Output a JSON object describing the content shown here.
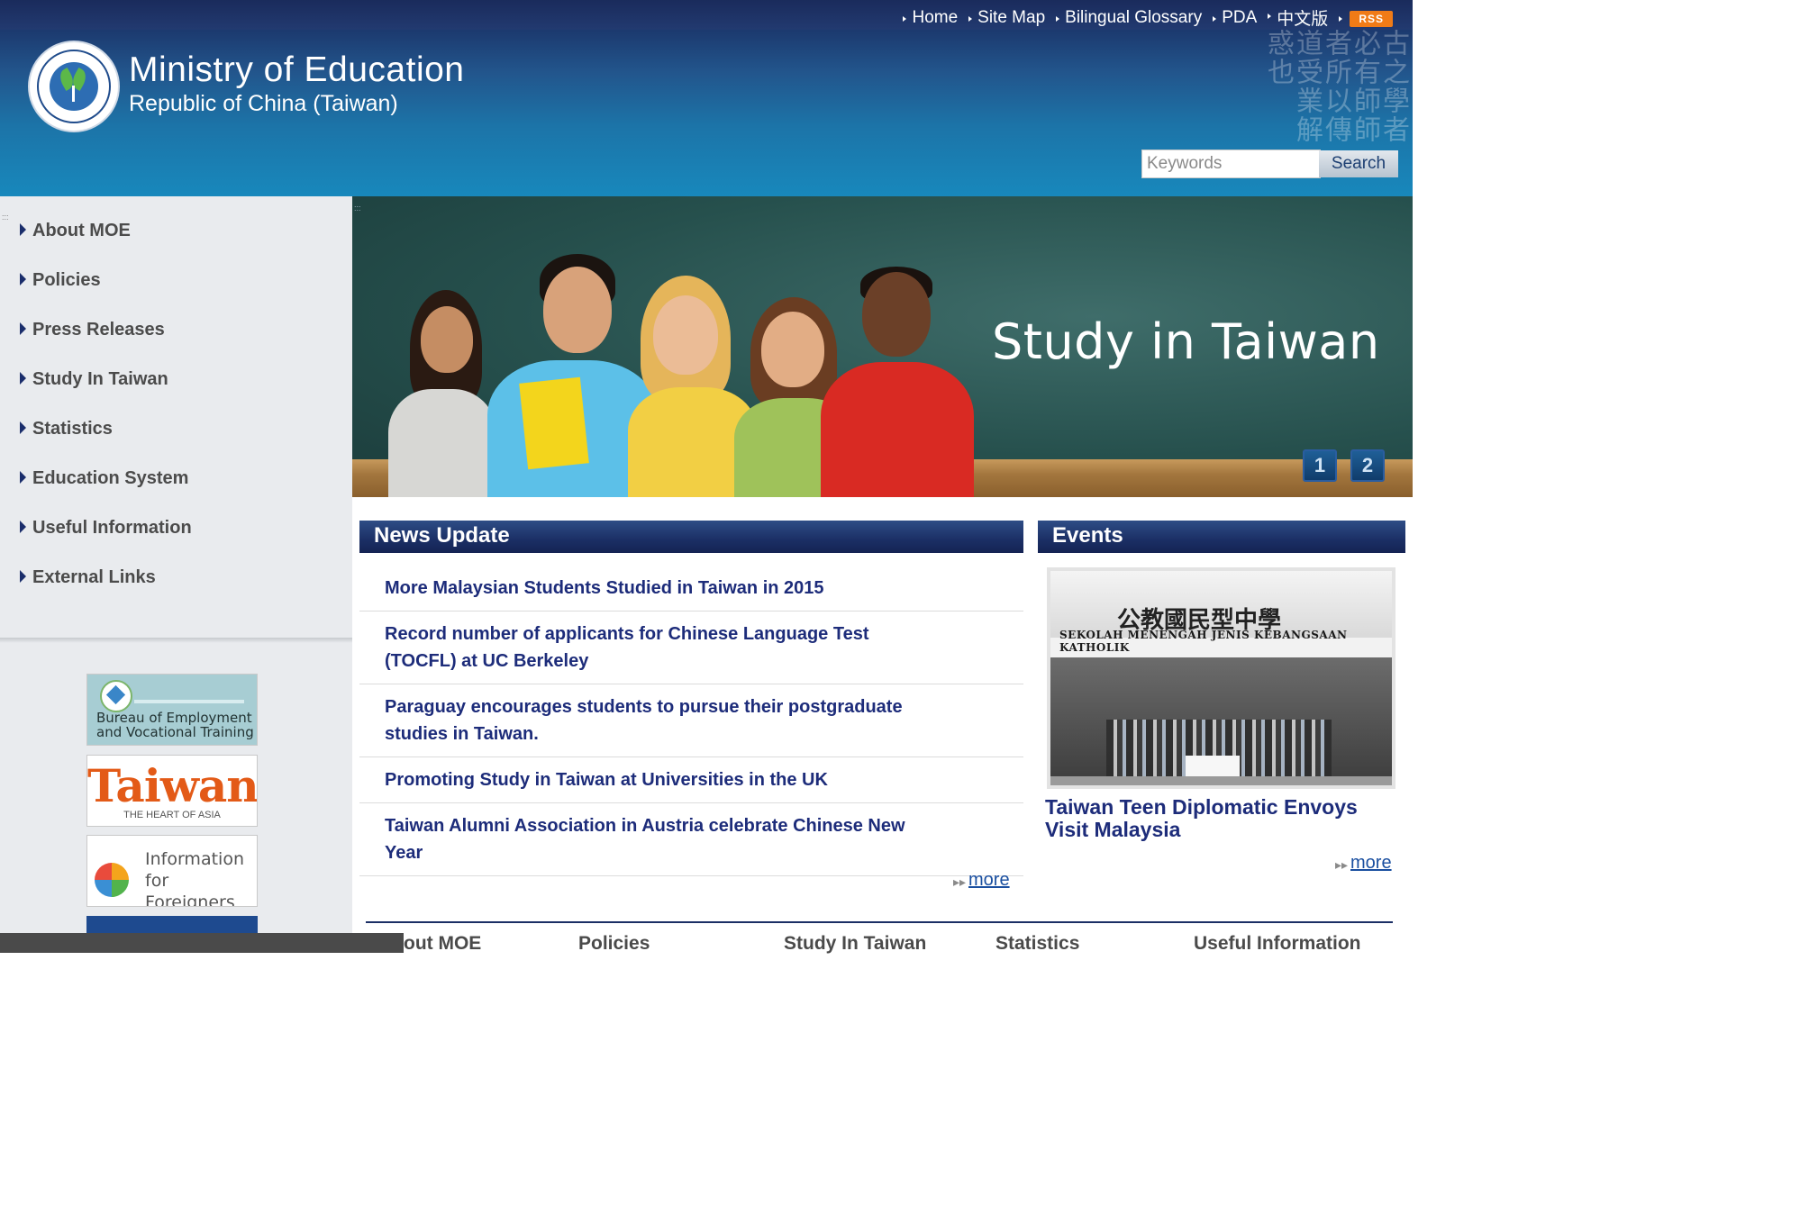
{
  "topnav": {
    "items": [
      {
        "label": "Home"
      },
      {
        "label": "Site Map"
      },
      {
        "label": "Bilingual Glossary"
      },
      {
        "label": "PDA"
      },
      {
        "label": "中文版"
      }
    ],
    "rss_label": "RSS"
  },
  "header": {
    "title": "Ministry of Education",
    "subtitle": "Republic of China (Taiwan)",
    "calligraphy": "古之學者必有師師者所以傳道受業解惑也",
    "search": {
      "placeholder": "Keywords",
      "button_label": "Search"
    }
  },
  "sidebar": {
    "menu": [
      {
        "label": "About MOE"
      },
      {
        "label": "Policies"
      },
      {
        "label": "Press Releases"
      },
      {
        "label": "Study In Taiwan"
      },
      {
        "label": "Statistics"
      },
      {
        "label": "Education System"
      },
      {
        "label": "Useful Information"
      },
      {
        "label": "External Links"
      }
    ],
    "banners": {
      "bevt": "Bureau of Employment and Vocational Training",
      "taiwan_title": "Taiwan",
      "taiwan_tagline": "THE HEART OF ASIA",
      "info": "Information for Foreigners"
    }
  },
  "slideshow": {
    "caption": "Study in Taiwan",
    "pages": [
      "1",
      "2"
    ]
  },
  "news": {
    "heading": "News Update",
    "items": [
      {
        "title": "More Malaysian Students Studied in Taiwan in 2015"
      },
      {
        "title": "Record number of applicants for Chinese Language Test (TOCFL) at UC Berkeley"
      },
      {
        "title": "Paraguay encourages students to pursue their postgraduate studies in Taiwan."
      },
      {
        "title": "Promoting Study in Taiwan at Universities in the UK"
      },
      {
        "title": "Taiwan Alumni Association in Austria celebrate Chinese New Year"
      }
    ],
    "more_label": "more"
  },
  "events": {
    "heading": "Events",
    "photo": {
      "sign_chinese": "公教國民型中學",
      "sign_malay": "SEKOLAH MENENGAH JENIS KEBANGSAAN KATHOLIK"
    },
    "title": "Taiwan Teen Diplomatic Envoys Visit Malaysia",
    "more_label": "more"
  },
  "footer_nav": [
    {
      "label": "out MOE"
    },
    {
      "label": "Policies"
    },
    {
      "label": "Study In Taiwan"
    },
    {
      "label": "Statistics"
    },
    {
      "label": "Useful Information"
    }
  ],
  "colors": {
    "header_top": "#1e3166",
    "header_bottom": "#1888bc",
    "link_navy": "#1d2c7a",
    "rss_orange": "#f07b17",
    "section_head": "#1b2f65"
  }
}
